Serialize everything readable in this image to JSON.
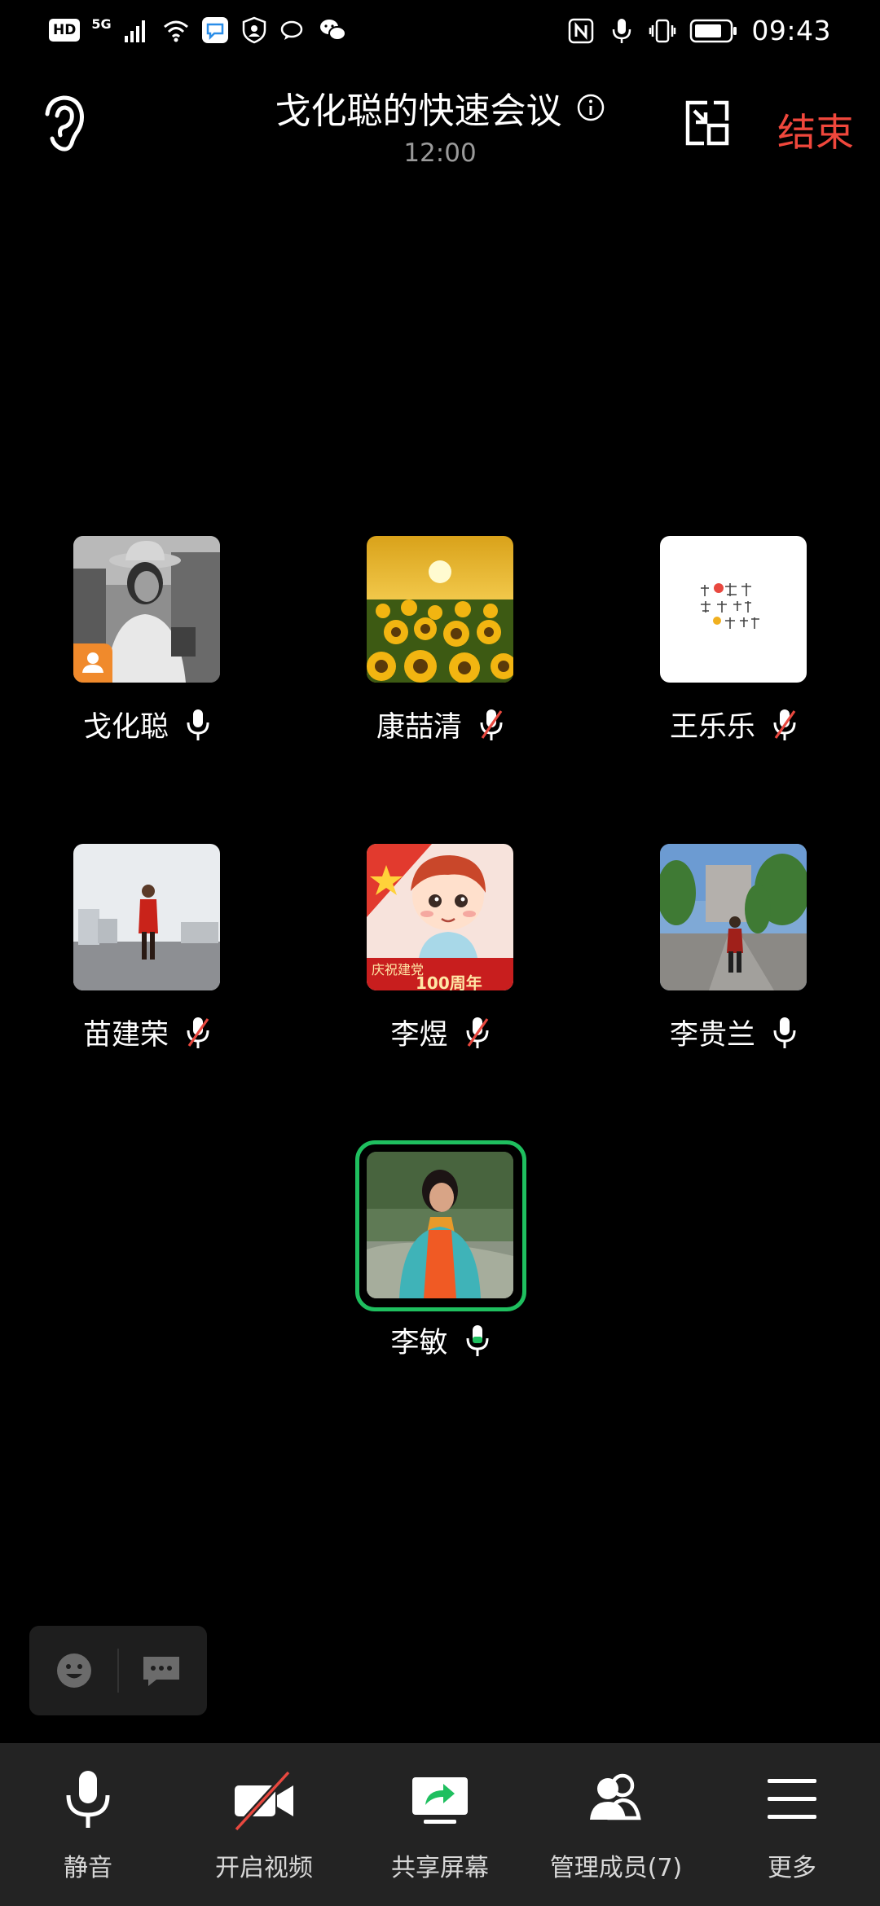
{
  "status_bar": {
    "hd": "HD",
    "network": "5G",
    "time": "09:43"
  },
  "header": {
    "title": "戈化聪的快速会议",
    "timer": "12:00",
    "end_label": "结束",
    "end_color": "#f0473c"
  },
  "participants": [
    {
      "name": "戈化聪",
      "mic": "on",
      "role": "host",
      "avatar": "woman-hat-bw"
    },
    {
      "name": "康喆清",
      "mic": "muted",
      "avatar": "sunflowers"
    },
    {
      "name": "王乐乐",
      "mic": "muted",
      "avatar": "handwriting-white"
    },
    {
      "name": "苗建荣",
      "mic": "muted",
      "avatar": "person-plaza"
    },
    {
      "name": "李煜",
      "mic": "muted",
      "avatar": "cartoon-flag",
      "avatar_text": "庆祝建党 100周年"
    },
    {
      "name": "李贵兰",
      "mic": "on",
      "avatar": "person-street"
    },
    {
      "name": "李敏",
      "mic": "on",
      "speaking": true,
      "avatar": "woman-scarf"
    }
  ],
  "quickbar": {
    "emoji_icon": "emoji-icon",
    "chat_icon": "chat-bubble-icon"
  },
  "toolbar": {
    "mute_label": "静音",
    "video_label": "开启视频",
    "share_label": "共享屏幕",
    "members_label": "管理成员(7)",
    "more_label": "更多"
  },
  "colors": {
    "background": "#000000",
    "end": "#f0473c",
    "speaking": "#1fbf5f",
    "muted_slash": "#e8483f",
    "host_badge": "#f08a2c",
    "toolbar_bg": "#232323"
  }
}
